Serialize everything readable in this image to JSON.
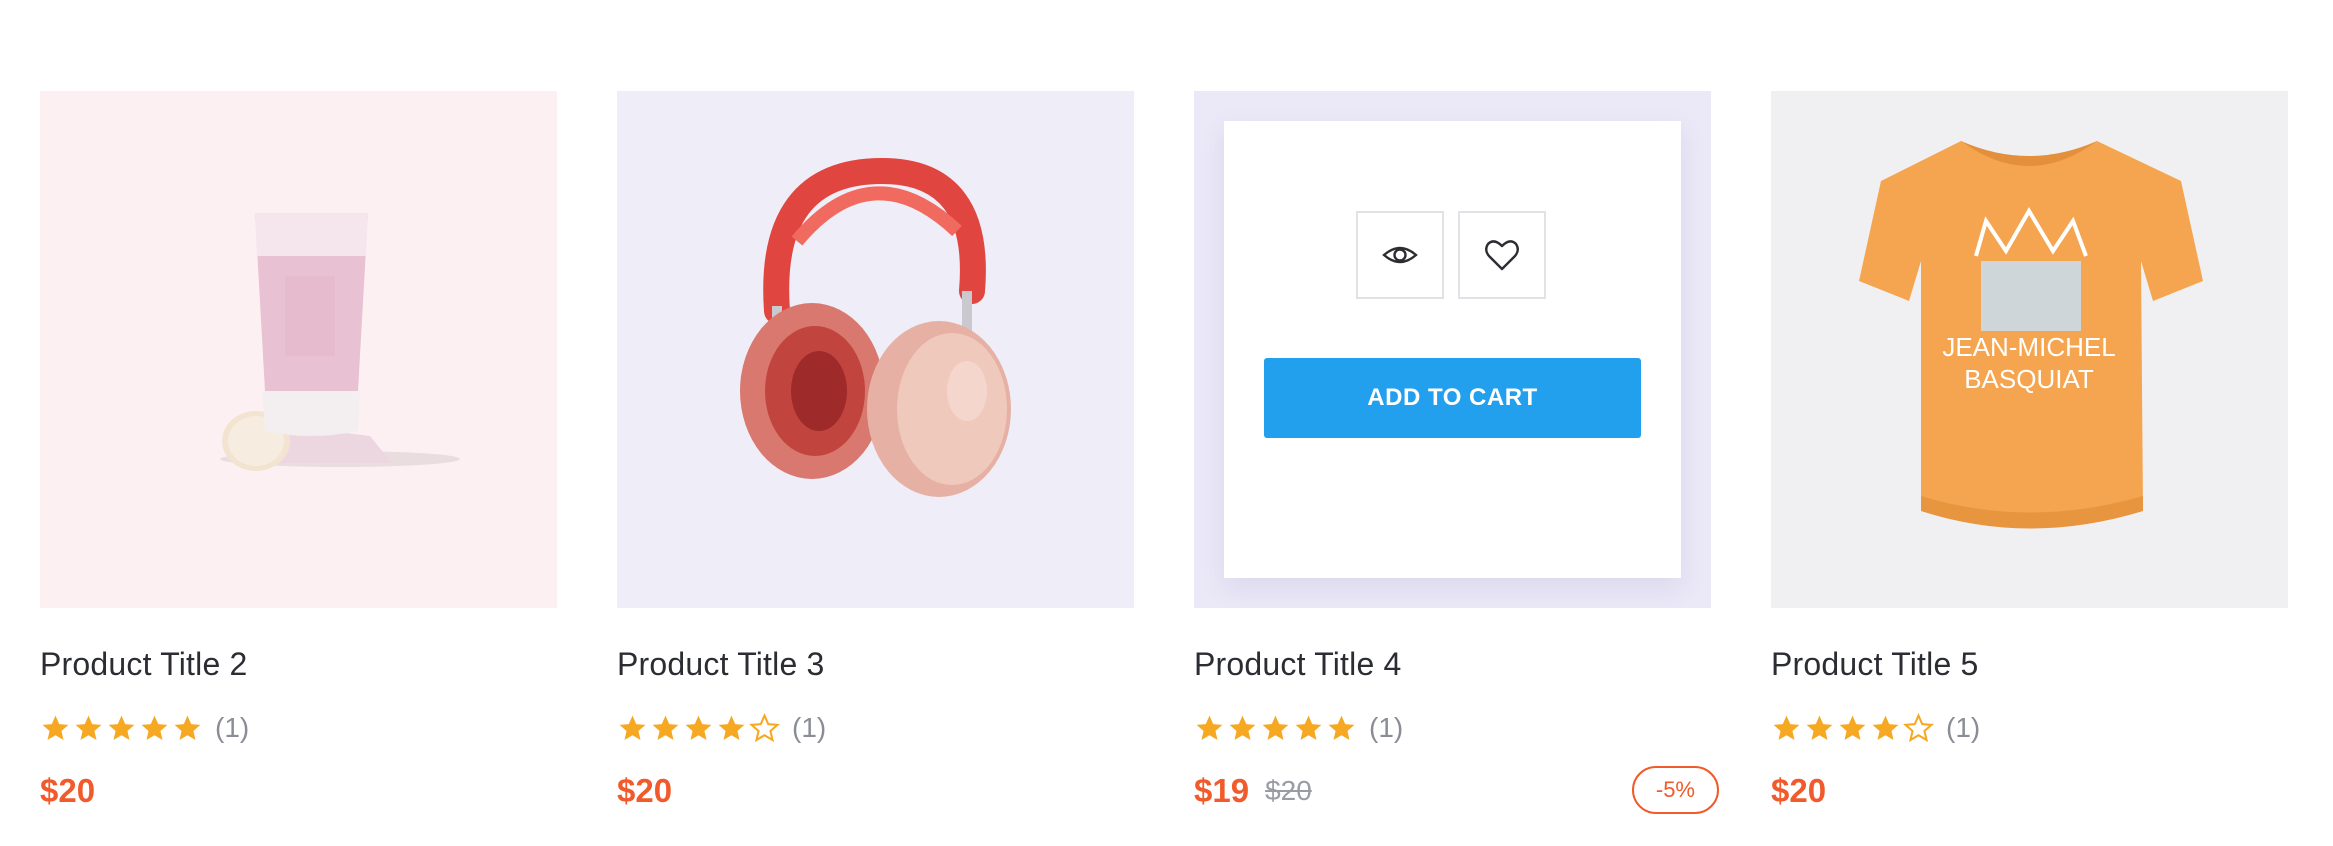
{
  "colors": {
    "price": "#f15a2b",
    "star": "#f7a823",
    "button": "#22a0ee"
  },
  "products": [
    {
      "title": "Product Title 2",
      "rating": 5,
      "rating_max": 5,
      "reviews": "(1)",
      "price": "$20",
      "image": "cosmetic-tube-image"
    },
    {
      "title": "Product Title 3",
      "rating": 4,
      "rating_max": 5,
      "reviews": "(1)",
      "price": "$20",
      "image": "headphones-image"
    },
    {
      "title": "Product Title 4",
      "rating": 5,
      "rating_max": 5,
      "reviews": "(1)",
      "price": "$19",
      "old_price": "$20",
      "discount": "-5%",
      "add_to_cart": "ADD TO CART",
      "quick_view_icon": "eye-icon",
      "wishlist_icon": "heart-icon"
    },
    {
      "title": "Product Title 5",
      "rating": 4,
      "rating_max": 5,
      "reviews": "(1)",
      "price": "$20",
      "image": "tshirt-image",
      "tshirt_print": [
        "JEAN-MICHEL",
        "BASQUIAT"
      ]
    }
  ]
}
